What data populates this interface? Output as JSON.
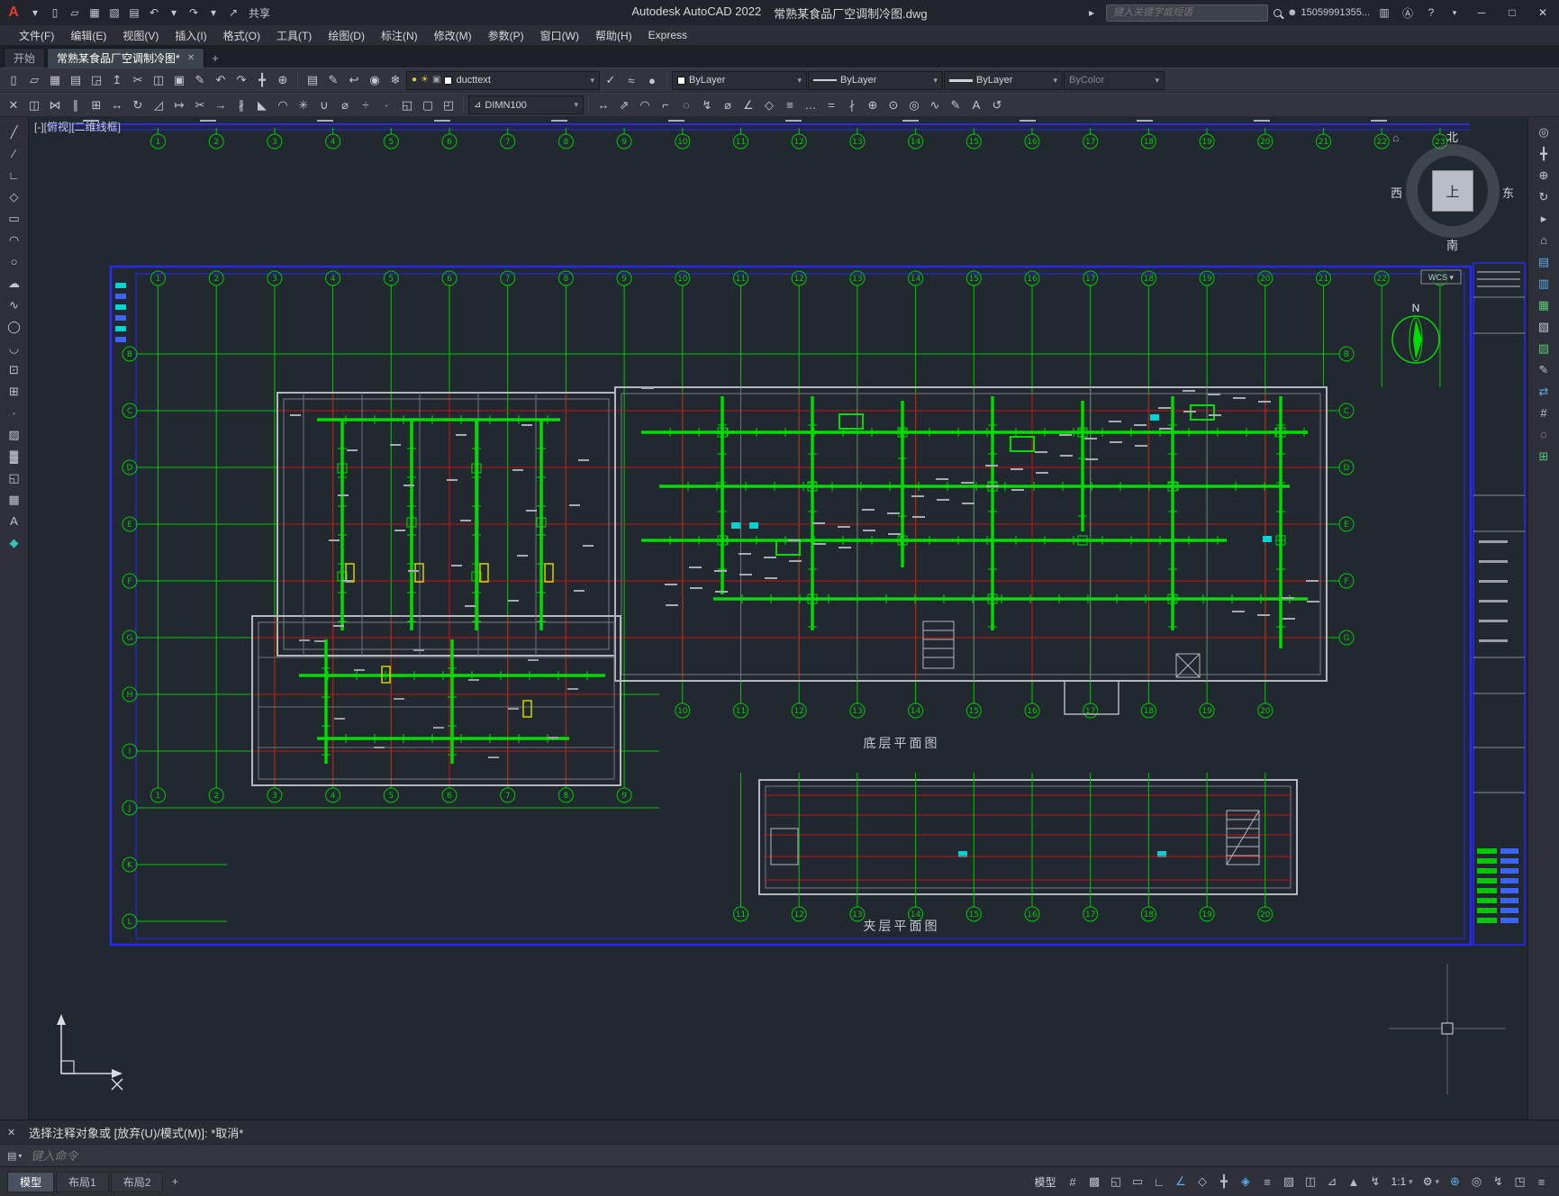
{
  "colors": {
    "grid_green": "#00c800",
    "duct_green": "#00dc00",
    "axis_red": "#c81414",
    "frame_blue": "#2828ff",
    "cyan": "#00d2d2",
    "yellow": "#d2d200",
    "accent_blue": "#53b0f8"
  },
  "titlebar": {
    "app_title": "Autodesk AutoCAD 2022",
    "doc_title": "常熟某食品厂空调制冷图.dwg",
    "share_label": "共享",
    "search_placeholder": "键入关键字或短语",
    "user_name": "15059991355...",
    "quick_icons": [
      {
        "name": "app-menu-arrow-icon",
        "glyph": "▾"
      },
      {
        "name": "new-icon",
        "glyph": "▯"
      },
      {
        "name": "open-icon",
        "glyph": "▱"
      },
      {
        "name": "save-icon",
        "glyph": "▦"
      },
      {
        "name": "save-as-icon",
        "glyph": "▧"
      },
      {
        "name": "plot-icon",
        "glyph": "▤"
      },
      {
        "name": "undo-icon",
        "glyph": "↶"
      },
      {
        "name": "undo-arrow-icon",
        "glyph": "▾"
      },
      {
        "name": "redo-icon",
        "glyph": "↷"
      },
      {
        "name": "redo-arrow-icon",
        "glyph": "▾"
      },
      {
        "name": "share-icon",
        "glyph": "↗"
      }
    ]
  },
  "menubar": {
    "items": [
      "文件(F)",
      "编辑(E)",
      "视图(V)",
      "插入(I)",
      "格式(O)",
      "工具(T)",
      "绘图(D)",
      "标注(N)",
      "修改(M)",
      "参数(P)",
      "窗口(W)",
      "帮助(H)",
      "Express"
    ]
  },
  "filetabs": {
    "home": "开始",
    "doc": "常熟某食品厂空调制冷图*",
    "close_glyph": "✕",
    "add_glyph": "+"
  },
  "toolbar1": {
    "layer_value": "ducttext",
    "color_value": "ByLayer",
    "linetype_value": "ByLayer",
    "lineweight_value": "ByLayer",
    "plotstyle_value": "ByColor",
    "icons_main": [
      {
        "name": "qnew-icon",
        "glyph": "▯"
      },
      {
        "name": "open-icon",
        "glyph": "▱"
      },
      {
        "name": "save-icon",
        "glyph": "▦"
      },
      {
        "name": "plot-icon",
        "glyph": "▤"
      },
      {
        "name": "plot-preview-icon",
        "glyph": "◲"
      },
      {
        "name": "publish-icon",
        "glyph": "↥"
      },
      {
        "name": "cut-icon",
        "glyph": "✂"
      },
      {
        "name": "copy-icon",
        "glyph": "◫"
      },
      {
        "name": "paste-icon",
        "glyph": "▣"
      },
      {
        "name": "match-properties-icon",
        "glyph": "✎"
      },
      {
        "name": "undo-icon",
        "glyph": "↶"
      },
      {
        "name": "redo-icon",
        "glyph": "↷"
      },
      {
        "name": "pan-icon",
        "glyph": "╋"
      },
      {
        "name": "zoom-realtime-icon",
        "glyph": "⊕"
      }
    ],
    "icons_layer_tools": [
      {
        "name": "layer-properties-icon",
        "glyph": "▤"
      },
      {
        "name": "layer-match-icon",
        "glyph": "✎"
      },
      {
        "name": "layer-previous-icon",
        "glyph": "↩"
      },
      {
        "name": "layer-isolate-icon",
        "glyph": "◉"
      },
      {
        "name": "layer-freeze-icon",
        "glyph": "❄"
      }
    ],
    "icons_layer_extra": [
      {
        "name": "make-object-layer-current-icon",
        "glyph": "✓"
      },
      {
        "name": "layer-walk-icon",
        "glyph": "≈"
      },
      {
        "name": "layer-off-icon",
        "glyph": "●"
      }
    ]
  },
  "toolbar2": {
    "dimstyle_value": "DIMN100",
    "icons_modify": [
      {
        "name": "erase-icon",
        "glyph": "✕"
      },
      {
        "name": "copy-object-icon",
        "glyph": "◫"
      },
      {
        "name": "mirror-icon",
        "glyph": "⋈"
      },
      {
        "name": "offset-icon",
        "glyph": "∥"
      },
      {
        "name": "array-icon",
        "glyph": "⊞"
      },
      {
        "name": "move-icon",
        "glyph": "↔"
      },
      {
        "name": "rotate-icon",
        "glyph": "↻"
      },
      {
        "name": "scale-icon",
        "glyph": "◿"
      },
      {
        "name": "stretch-icon",
        "glyph": "↦"
      },
      {
        "name": "trim-icon",
        "glyph": "✂"
      },
      {
        "name": "extend-icon",
        "glyph": "→"
      },
      {
        "name": "break-icon",
        "glyph": "∦"
      },
      {
        "name": "chamfer-icon",
        "glyph": "◣"
      },
      {
        "name": "fillet-icon",
        "glyph": "◠"
      },
      {
        "name": "explode-icon",
        "glyph": "✳"
      },
      {
        "name": "join-icon",
        "glyph": "∪"
      },
      {
        "name": "measure-icon",
        "glyph": "⌀"
      },
      {
        "name": "divide-icon",
        "glyph": "÷"
      },
      {
        "name": "point-style-icon",
        "glyph": "∙"
      },
      {
        "name": "region-icon",
        "glyph": "◱"
      },
      {
        "name": "boundary-icon",
        "glyph": "▢"
      },
      {
        "name": "group-icon",
        "glyph": "◰"
      }
    ],
    "icons_dimension": [
      {
        "name": "dim-linear-icon",
        "glyph": "↔"
      },
      {
        "name": "dim-aligned-icon",
        "glyph": "⇗"
      },
      {
        "name": "dim-arc-length-icon",
        "glyph": "◠"
      },
      {
        "name": "dim-ordinate-icon",
        "glyph": "⌐"
      },
      {
        "name": "dim-radius-icon",
        "glyph": "◌"
      },
      {
        "name": "dim-jogged-icon",
        "glyph": "↯"
      },
      {
        "name": "dim-diameter-icon",
        "glyph": "⌀"
      },
      {
        "name": "dim-angular-icon",
        "glyph": "∠"
      },
      {
        "name": "dim-quick-icon",
        "glyph": "◇"
      },
      {
        "name": "dim-baseline-icon",
        "glyph": "≡"
      },
      {
        "name": "dim-continue-icon",
        "glyph": "…"
      },
      {
        "name": "dim-space-icon",
        "glyph": "="
      },
      {
        "name": "dim-break-icon",
        "glyph": "∤"
      },
      {
        "name": "dim-tolerance-icon",
        "glyph": "⊕"
      },
      {
        "name": "dim-center-mark-icon",
        "glyph": "⊙"
      },
      {
        "name": "dim-inspect-icon",
        "glyph": "◎"
      },
      {
        "name": "dim-jog-line-icon",
        "glyph": "∿"
      },
      {
        "name": "dim-edit-icon",
        "glyph": "✎"
      },
      {
        "name": "dim-text-edit-icon",
        "glyph": "A"
      },
      {
        "name": "dim-update-icon",
        "glyph": "↺"
      }
    ]
  },
  "palettes": {
    "left_icons": [
      {
        "name": "line-icon",
        "glyph": "╱"
      },
      {
        "name": "construction-line-icon",
        "glyph": "∕"
      },
      {
        "name": "polyline-icon",
        "glyph": "∟"
      },
      {
        "name": "polygon-icon",
        "glyph": "◇"
      },
      {
        "name": "rectangle-icon",
        "glyph": "▭"
      },
      {
        "name": "arc-icon",
        "glyph": "◠"
      },
      {
        "name": "circle-icon",
        "glyph": "○"
      },
      {
        "name": "revision-cloud-icon",
        "glyph": "☁"
      },
      {
        "name": "spline-icon",
        "glyph": "∿"
      },
      {
        "name": "ellipse-icon",
        "glyph": "◯"
      },
      {
        "name": "ellipse-arc-icon",
        "glyph": "◡"
      },
      {
        "name": "insert-block-icon",
        "glyph": "⊡"
      },
      {
        "name": "create-block-icon",
        "glyph": "⊞"
      },
      {
        "name": "point-icon",
        "glyph": "·"
      },
      {
        "name": "hatch-icon",
        "glyph": "▨"
      },
      {
        "name": "gradient-icon",
        "glyph": "▓"
      },
      {
        "name": "region-icon",
        "glyph": "◱"
      },
      {
        "name": "table-icon",
        "glyph": "▦"
      },
      {
        "name": "multiline-text-icon",
        "glyph": "A"
      },
      {
        "name": "color-swatch-icon",
        "glyph": "◆",
        "color": "#2fbfbf"
      }
    ],
    "right_icons": [
      {
        "name": "navigation-wheel-icon",
        "glyph": "◎"
      },
      {
        "name": "pan-hand-icon",
        "glyph": "╋"
      },
      {
        "name": "zoom-extents-icon",
        "glyph": "⊕"
      },
      {
        "name": "orbit-icon",
        "glyph": "↻"
      },
      {
        "name": "showmotion-icon",
        "glyph": "▸"
      },
      {
        "name": "viewcube-home-icon",
        "glyph": "⌂"
      },
      {
        "name": "named-views-icon",
        "glyph": "▤",
        "color": "#5aa8e8"
      },
      {
        "name": "properties-palette-icon",
        "glyph": "▥",
        "color": "#5aa8e8"
      },
      {
        "name": "design-center-icon",
        "glyph": "▦",
        "color": "#58c878"
      },
      {
        "name": "tool-palettes-icon",
        "glyph": "▧"
      },
      {
        "name": "sheet-set-manager-icon",
        "glyph": "▨",
        "color": "#58c878"
      },
      {
        "name": "markup-import-icon",
        "glyph": "✎"
      },
      {
        "name": "drawing-compare-icon",
        "glyph": "⇄",
        "color": "#5aa8e8"
      },
      {
        "name": "count-icon",
        "glyph": "#"
      },
      {
        "name": "trace-icon",
        "glyph": "◌"
      },
      {
        "name": "blocks-palette-icon",
        "glyph": "⊞",
        "color": "#58c878"
      }
    ]
  },
  "canvas": {
    "viewport_label": "[-][俯视][二维线框]",
    "wcs_label": "WCS ▾",
    "north_label": "N",
    "plan_bottom_label": "底层平面图",
    "plan_mezz_label": "夹层平面图",
    "grid_cols": [
      "1",
      "2",
      "3",
      "4",
      "5",
      "6",
      "7",
      "8",
      "9",
      "10",
      "11",
      "12",
      "13",
      "14",
      "15",
      "16",
      "17",
      "18",
      "19",
      "20",
      "21",
      "22",
      "23"
    ],
    "grid_rows": [
      "B",
      "C",
      "D",
      "E",
      "F",
      "G",
      "H",
      "I",
      "J",
      "K",
      "L"
    ],
    "mezz_cols": [
      "11",
      "12",
      "13",
      "14",
      "15",
      "16",
      "17",
      "18",
      "19",
      "20"
    ],
    "viewcube": {
      "face": "上",
      "north": "北",
      "south": "南",
      "west": "西",
      "east": "东"
    }
  },
  "cmdline": {
    "history": "选择注释对象或 [放弃(U)/模式(M)]: *取消*",
    "prompt_placeholder": "键入命令"
  },
  "statusbar": {
    "tabs": [
      "模型",
      "布局1",
      "布局2"
    ],
    "add_tab_label": "+",
    "model_label": "模型",
    "scale_label": "1:1",
    "icons_a": [
      {
        "name": "grid-display-icon",
        "glyph": "#"
      },
      {
        "name": "snap-mode-icon",
        "glyph": "▩"
      },
      {
        "name": "infer-constraints-icon",
        "glyph": "◱"
      },
      {
        "name": "dynamic-input-icon",
        "glyph": "▭"
      },
      {
        "name": "ortho-mode-icon",
        "glyph": "∟"
      },
      {
        "name": "polar-tracking-icon",
        "glyph": "∠",
        "active": true
      },
      {
        "name": "isometric-drafting-icon",
        "glyph": "◇"
      },
      {
        "name": "object-snap-tracking-icon",
        "glyph": "╋"
      },
      {
        "name": "object-snap-icon",
        "glyph": "◈",
        "active": true
      },
      {
        "name": "lineweight-display-icon",
        "glyph": "≡"
      },
      {
        "name": "transparency-icon",
        "glyph": "▨"
      },
      {
        "name": "selection-cycling-icon",
        "glyph": "◫"
      },
      {
        "name": "dynamic-ucs-icon",
        "glyph": "⊿"
      },
      {
        "name": "annotation-visibility-icon",
        "glyph": "▲"
      },
      {
        "name": "autoscale-icon",
        "glyph": "↯"
      }
    ],
    "icons_b": [
      {
        "name": "annotation-monitor-icon",
        "glyph": "⊕",
        "active": true
      },
      {
        "name": "isolate-objects-icon",
        "glyph": "◎"
      },
      {
        "name": "graphics-performance-icon",
        "glyph": "↯"
      },
      {
        "name": "clean-screen-icon",
        "glyph": "◳"
      },
      {
        "name": "customization-icon",
        "glyph": "≡"
      }
    ]
  }
}
